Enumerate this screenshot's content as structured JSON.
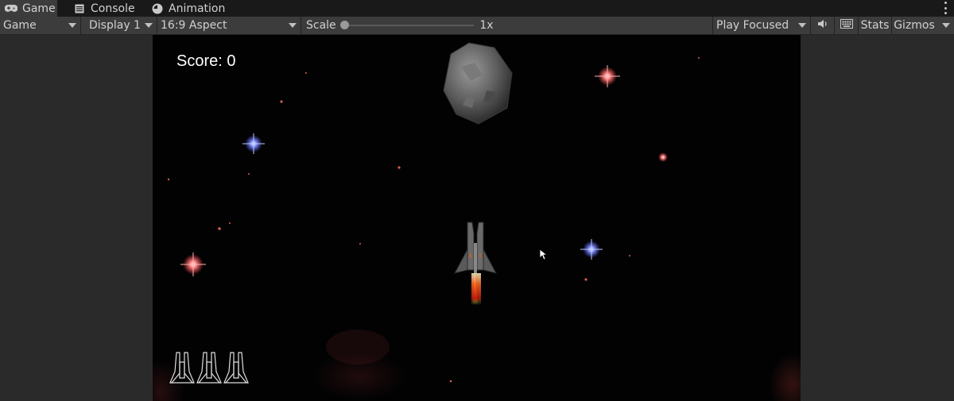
{
  "tabs": [
    {
      "label": "Game",
      "icon": "gamepad-icon",
      "active": true
    },
    {
      "label": "Console",
      "icon": "console-icon",
      "active": false
    },
    {
      "label": "Animation",
      "icon": "animation-icon",
      "active": false
    }
  ],
  "toolbar": {
    "view_mode": "Game",
    "display": "Display 1",
    "aspect": "16:9 Aspect",
    "scale_label": "Scale",
    "scale_value": "1x",
    "play_mode": "Play Focused",
    "stats_label": "Stats",
    "gizmos_label": "Gizmos"
  },
  "game": {
    "score_text": "Score: 0",
    "lives_count": 3
  },
  "colors": {
    "editor_bg": "#1e1e1e",
    "toolbar_bg": "#3c3c3c",
    "game_bg": "#020203",
    "text": "#ffffff"
  }
}
